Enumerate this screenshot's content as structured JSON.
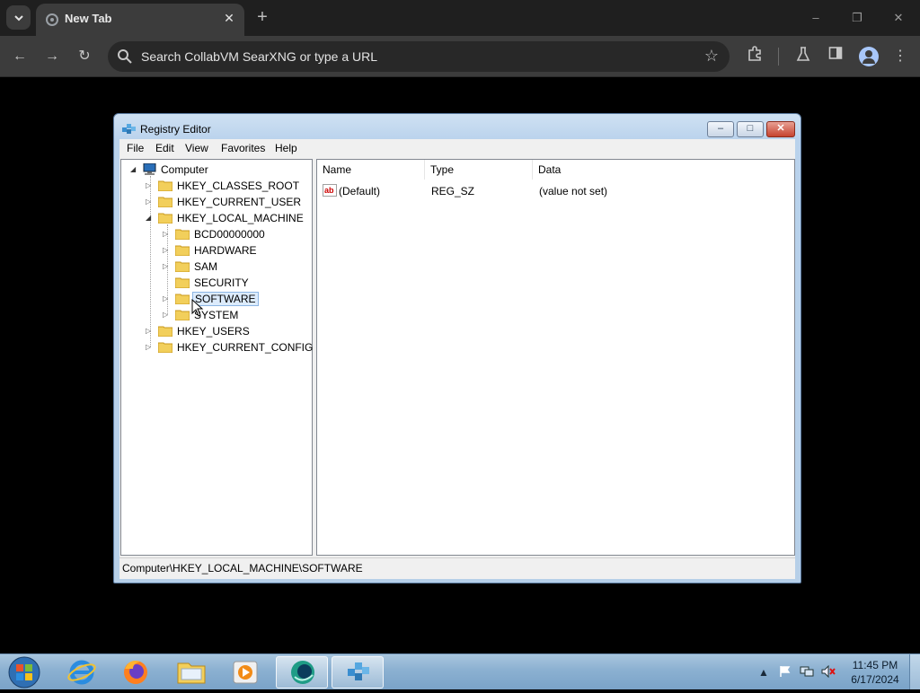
{
  "browser": {
    "tab": {
      "title": "New Tab",
      "close_icon": "close-icon"
    },
    "window_controls": {
      "minimize": "–",
      "restore": "❐",
      "close": "✕"
    },
    "toolbar": {
      "back": "←",
      "forward": "→",
      "reload": "↻",
      "omnibox_placeholder": "Search CollabVM SearXNG or type a URL",
      "bookmark_star": "☆",
      "menu": "⋮"
    }
  },
  "regedit": {
    "title": "Registry Editor",
    "buttons": {
      "minimize": "–",
      "maximize": "□",
      "close": "✕"
    },
    "menu": [
      "File",
      "Edit",
      "View",
      "Favorites",
      "Help"
    ],
    "tree": {
      "root": "Computer",
      "hives": [
        "HKEY_CLASSES_ROOT",
        "HKEY_CURRENT_USER",
        "HKEY_LOCAL_MACHINE"
      ],
      "hklm_children": [
        "BCD00000000",
        "HARDWARE",
        "SAM",
        "SECURITY",
        "SOFTWARE",
        "SYSTEM"
      ],
      "hives_after": [
        "HKEY_USERS",
        "HKEY_CURRENT_CONFIG"
      ],
      "selected": "SOFTWARE"
    },
    "list": {
      "columns": [
        "Name",
        "Type",
        "Data"
      ],
      "rows": [
        {
          "name": "(Default)",
          "type": "REG_SZ",
          "data": "(value not set)"
        }
      ]
    },
    "status": "Computer\\HKEY_LOCAL_MACHINE\\SOFTWARE"
  },
  "taskbar": {
    "apps": [
      "internet-explorer",
      "firefox",
      "file-explorer",
      "media-player",
      "collabvm",
      "registry-editor"
    ],
    "clock": {
      "time": "11:45 PM",
      "date": "6/17/2024"
    },
    "tray_arrow": "▲"
  },
  "colors": {
    "accent": "#a8c7fa",
    "selection": "#dcebfc"
  }
}
